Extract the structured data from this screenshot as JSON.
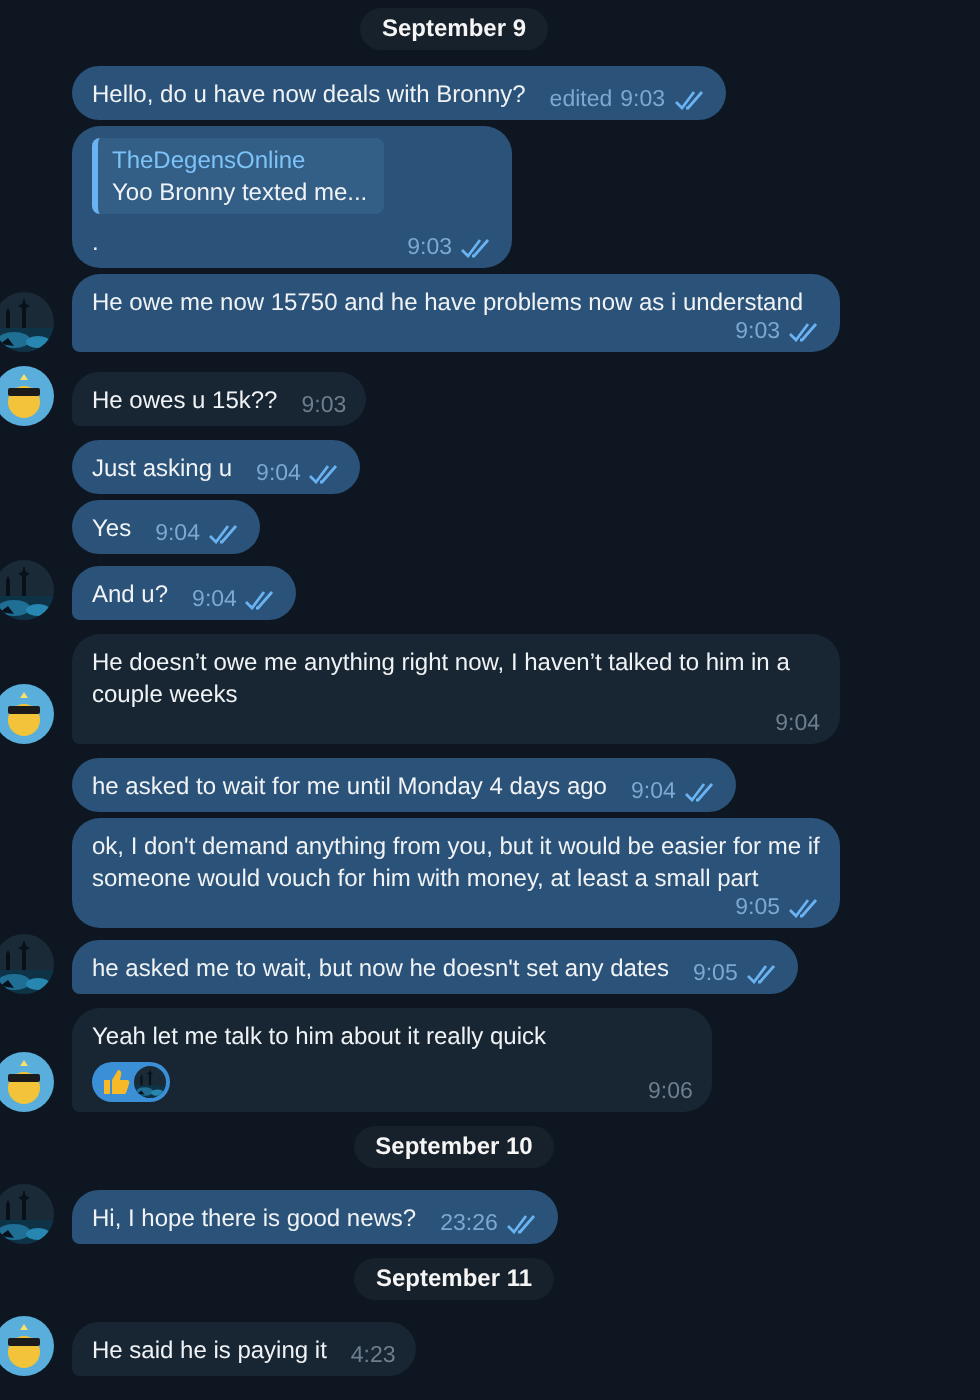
{
  "items": [
    {
      "kind": "date",
      "text": "September 9"
    },
    {
      "kind": "message",
      "outgoing": true,
      "text": "Hello, do u have now deals with Bronny?",
      "edited": "edited",
      "time": "9:03",
      "read": true
    },
    {
      "kind": "message",
      "outgoing": true,
      "reply": {
        "author": "TheDegensOnline",
        "text": "Yoo Bronny texted me..."
      },
      "text": ".",
      "time": "9:03",
      "read": true
    },
    {
      "kind": "message",
      "outgoing": true,
      "text": "He owe me now 15750 and he have problems now as i understand",
      "time": "9:03",
      "read": true
    },
    {
      "kind": "message",
      "outgoing": false,
      "text": "He owes u 15k??",
      "time": "9:03",
      "avatar": {
        "kind": "emoji"
      }
    },
    {
      "kind": "message",
      "outgoing": true,
      "text": "Just asking u",
      "time": "9:04",
      "read": true
    },
    {
      "kind": "message",
      "outgoing": true,
      "text": "Yes",
      "time": "9:04",
      "read": true
    },
    {
      "kind": "message",
      "outgoing": true,
      "text": "And u?",
      "time": "9:04",
      "read": true
    },
    {
      "kind": "message",
      "outgoing": false,
      "text": "He doesn’t owe me anything right now, I haven’t talked to him in a couple weeks",
      "time": "9:04",
      "avatar": {
        "kind": "emoji"
      }
    },
    {
      "kind": "message",
      "outgoing": true,
      "text": "he asked to wait for me until Monday 4 days ago",
      "time": "9:04",
      "read": true
    },
    {
      "kind": "message",
      "outgoing": true,
      "text": "ok, I don't demand anything from you, but it would be easier for me if someone would vouch for him with money, at least a small part",
      "time": "9:05",
      "read": true
    },
    {
      "kind": "message",
      "outgoing": true,
      "text": "he asked me to wait, but now he doesn't set any dates",
      "time": "9:05",
      "read": true
    },
    {
      "kind": "message",
      "outgoing": false,
      "text": "Yeah let me talk to him about it really quick",
      "time": "9:06",
      "reaction": {
        "kind": "thumbs-up"
      },
      "avatar": {
        "kind": "emoji"
      }
    },
    {
      "kind": "date",
      "text": "September 10"
    },
    {
      "kind": "message",
      "outgoing": true,
      "text": "Hi, I hope there is good news?",
      "time": "23:26",
      "read": true
    },
    {
      "kind": "date",
      "text": "September 11"
    },
    {
      "kind": "message",
      "outgoing": false,
      "text": "He said he is paying it",
      "time": "4:23",
      "avatar": {
        "kind": "emoji"
      }
    }
  ]
}
